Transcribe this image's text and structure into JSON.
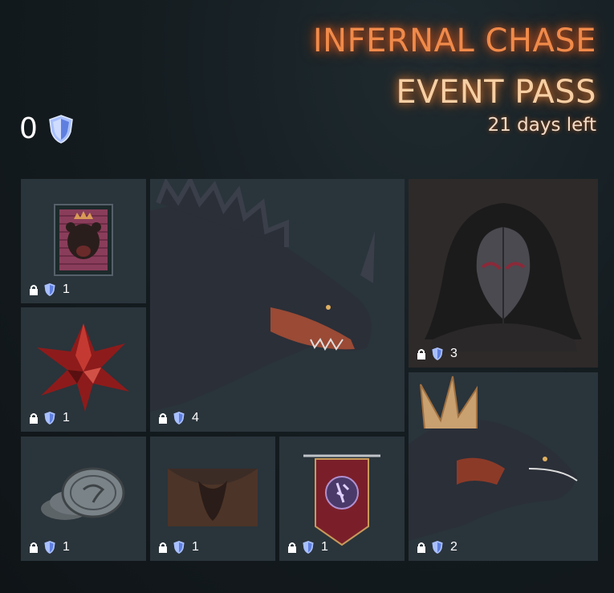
{
  "header": {
    "title_line1": "INFERNAL CHASE",
    "title_line2": "EVENT PASS",
    "time_left": "21 days left"
  },
  "balance": {
    "amount": "0",
    "icon": "shield-currency-icon"
  },
  "rewards": [
    {
      "name": "bear-emblem",
      "icon": "bear-crest-icon",
      "locked": true,
      "cost": "1"
    },
    {
      "name": "crimson-crystal",
      "icon": "red-crystal-icon",
      "locked": true,
      "cost": "1"
    },
    {
      "name": "black-dragon",
      "icon": "dragon-head-icon",
      "locked": true,
      "cost": "4"
    },
    {
      "name": "hooded-mask",
      "icon": "plague-mask-icon",
      "locked": true,
      "cost": "3"
    },
    {
      "name": "coins",
      "icon": "coin-stack-icon",
      "locked": true,
      "cost": "1"
    },
    {
      "name": "dark-banner-backdrop",
      "icon": "backdrop-icon",
      "locked": true,
      "cost": "1"
    },
    {
      "name": "rune-banner",
      "icon": "banner-icon",
      "locked": true,
      "cost": "1"
    },
    {
      "name": "horned-dragon",
      "icon": "dragon-head-icon",
      "locked": true,
      "cost": "2"
    }
  ],
  "colors": {
    "accent_orange": "#f08a4a",
    "title_cream": "#f7cfa4",
    "tile_bg": "#2a343b",
    "shield_blue": "#7fa0ff"
  }
}
